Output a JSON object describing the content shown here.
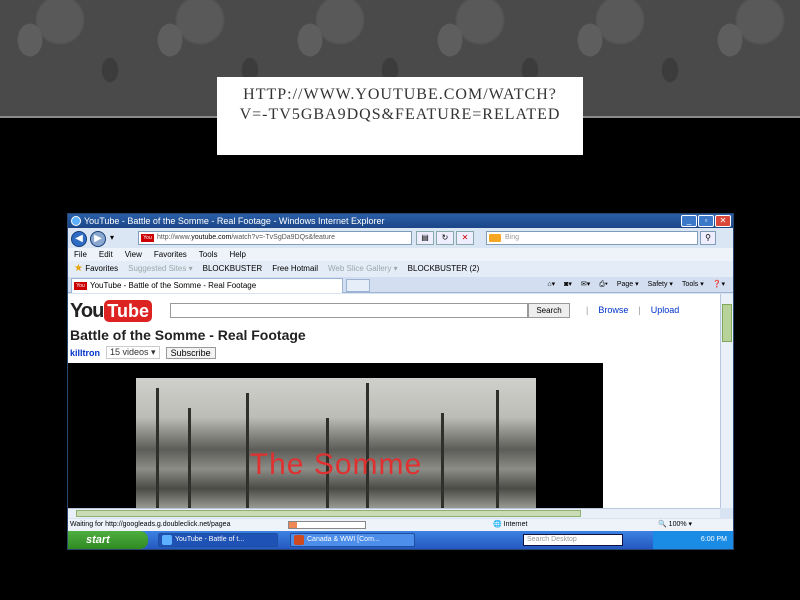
{
  "slide": {
    "title_line1": "HTTP://WWW.YOUTUBE.COM/WATCH?",
    "title_line2": "V=-TV5GBA9DQS&FEATURE=RELATED"
  },
  "browser": {
    "window_title": "YouTube - Battle of the Somme - Real Footage - Windows Internet Explorer",
    "address_prefix": "http://www.",
    "address_domain": "youtube.com",
    "address_rest": "/watch?v=-TvSgDa9DQs&feature",
    "search_placeholder": "Bing",
    "menu": [
      "File",
      "Edit",
      "View",
      "Favorites",
      "Tools",
      "Help"
    ],
    "favorites_label": "Favorites",
    "fav_links": [
      "Suggested Sites ▾",
      "BLOCKBUSTER",
      "Free Hotmail",
      "Web Slice Gallery ▾",
      "BLOCKBUSTER (2)"
    ],
    "tab_title": "YouTube - Battle of the Somme - Real Footage",
    "commands": [
      "Page ▾",
      "Safety ▾",
      "Tools ▾"
    ],
    "status_text": "Waiting for http://googleads.g.doubleclick.net/pagea",
    "status_progress": 0.1,
    "zone": "Internet",
    "zoom": "100%"
  },
  "youtube": {
    "logo_you": "You",
    "logo_tube": "Tube",
    "search_button": "Search",
    "browse": "Browse",
    "upload": "Upload",
    "video_title": "Battle of the Somme - Real Footage",
    "channel": "killtron",
    "videos_count": "15 videos",
    "subscribe": "Subscribe",
    "frame_text": "The Somme"
  },
  "taskbar": {
    "start": "start",
    "task1": "YouTube - Battle of t...",
    "task2": "Canada & WWI [Com...",
    "search_placeholder": "Search Desktop",
    "clock": "6:00 PM"
  }
}
